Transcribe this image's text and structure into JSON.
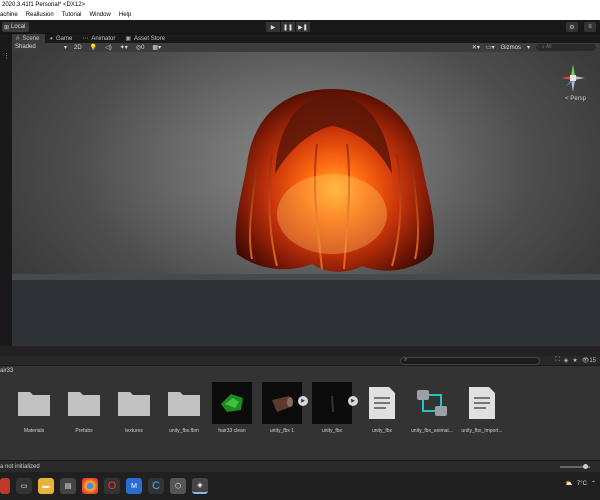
{
  "window": {
    "title": "2020.3.41f1 Personal* <DX12>"
  },
  "menu": [
    "achine",
    "Reallusion",
    "Tutorial",
    "Window",
    "Help"
  ],
  "toolbar": {
    "local_label": "Local"
  },
  "tabs": [
    {
      "label": "Scene",
      "icon": "grid-icon",
      "active": true
    },
    {
      "label": "Game",
      "icon": "pacman-icon",
      "active": false
    },
    {
      "label": "Animator",
      "icon": "animator-icon",
      "active": false
    },
    {
      "label": "Asset Store",
      "icon": "store-icon",
      "active": false
    }
  ],
  "scene_toolbar": {
    "shading_mode": "Shaded",
    "mode_2d": "2D",
    "gizmos_label": "Gizmos",
    "search_placeholder": "All"
  },
  "viewport": {
    "camera_label": "< Persp"
  },
  "project": {
    "breadcrumb": "air33",
    "assets": [
      {
        "name": "Materials",
        "kind": "folder"
      },
      {
        "name": "Prefabs",
        "kind": "folder"
      },
      {
        "name": "textures",
        "kind": "folder"
      },
      {
        "name": "unity_fbx.fbm",
        "kind": "folder"
      },
      {
        "name": "hair33 clean",
        "kind": "mesh-green"
      },
      {
        "name": "unity_fbx 1",
        "kind": "model"
      },
      {
        "name": "unity_fbx",
        "kind": "model-dark"
      },
      {
        "name": "unity_fbx",
        "kind": "document"
      },
      {
        "name": "unity_fbx_animat...",
        "kind": "animator-controller"
      },
      {
        "name": "unity_fbx_Import...",
        "kind": "document"
      }
    ]
  },
  "status": {
    "message": "a not initialized"
  },
  "taskbar": {
    "weather": "7°C",
    "apps": [
      "explorer",
      "files",
      "chrome",
      "opera",
      "reallusion",
      "character-creator",
      "unity-hub",
      "unity"
    ]
  },
  "colors": {
    "hair_core": "#ff6a10",
    "hair_dark": "#4a0e04",
    "accent_play": "#d8d8d8"
  }
}
